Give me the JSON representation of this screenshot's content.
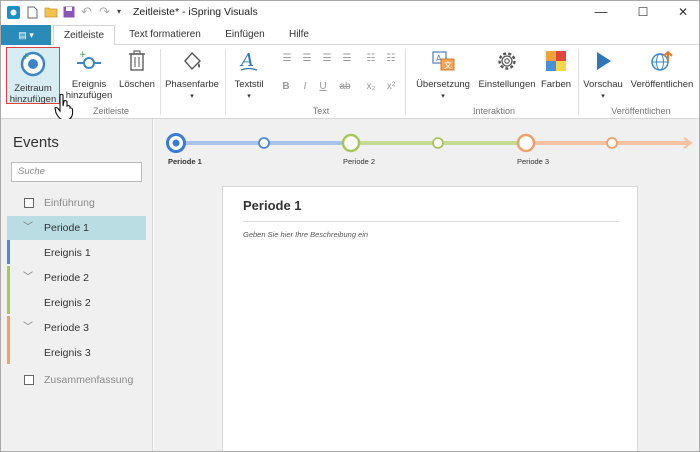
{
  "app": {
    "title": "Zeitleiste* - iSpring Visuals"
  },
  "window": {
    "minimize": "—",
    "maximize": "☐",
    "close": "✕"
  },
  "tabs": [
    {
      "label": "Zeitleiste",
      "active": true
    },
    {
      "label": "Text formatieren"
    },
    {
      "label": "Einfügen"
    },
    {
      "label": "Hilfe"
    }
  ],
  "ribbon": {
    "groups": {
      "zeitleiste": "Zeitleiste",
      "text": "Text",
      "interaktion": "Interaktion",
      "veroeffentlichen": "Veröffentlichen"
    },
    "buttons": {
      "zeitraum_l1": "Zeitraum",
      "zeitraum_l2": "hinzufügen",
      "ereignis_l1": "Ereignis",
      "ereignis_l2": "hinzufügen",
      "loeschen": "Löschen",
      "phasenfarbe": "Phasenfarbe",
      "textstil": "Textstil",
      "uebersetzung": "Übersetzung",
      "einstellungen": "Einstellungen",
      "farben": "Farben",
      "vorschau": "Vorschau",
      "veroeffentlichen": "Veröffentlichen"
    },
    "text_icons": {
      "bold": "B",
      "italic": "I",
      "strike": "ab",
      "subscript": "x₂",
      "superscript": "x²"
    }
  },
  "left_panel": {
    "title": "Events",
    "search_placeholder": "Suche",
    "items": [
      {
        "label": "Einführung"
      },
      {
        "label": "Periode 1"
      },
      {
        "label": "Ereignis 1"
      },
      {
        "label": "Periode 2"
      },
      {
        "label": "Ereignis 2"
      },
      {
        "label": "Periode 3"
      },
      {
        "label": "Ereignis 3"
      },
      {
        "label": "Zusammenfassung"
      }
    ]
  },
  "timeline": {
    "periods": [
      {
        "label": "Periode 1",
        "color": "#8fb3e8"
      },
      {
        "label": "Periode 2",
        "color": "#b5cf7a"
      },
      {
        "label": "Periode 3",
        "color": "#f0b48a"
      }
    ],
    "accent": "#3a7bd5"
  },
  "card": {
    "title": "Periode 1",
    "description": "Geben Sie hier Ihre Beschreibung ein"
  }
}
